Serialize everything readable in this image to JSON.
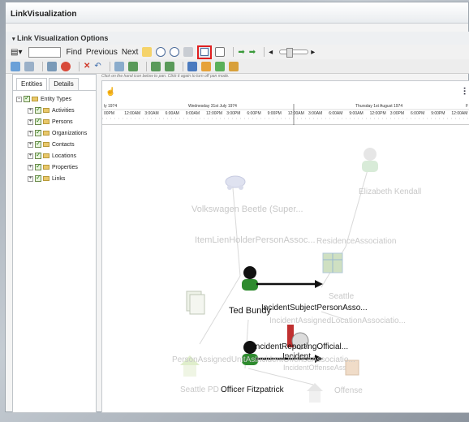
{
  "window": {
    "title": "LinkVisualization"
  },
  "panel": {
    "header": "Link Visualization Options"
  },
  "toolbar": {
    "find_label": "Find",
    "previous_label": "Previous",
    "next_label": "Next"
  },
  "side": {
    "tabs": [
      "Entities",
      "Details"
    ],
    "root": "Entity Types",
    "items": [
      "Activities",
      "Persons",
      "Organizations",
      "Contacts",
      "Locations",
      "Properties",
      "Links"
    ]
  },
  "hint": "Click on the hand icon below to pan. Click it again to turn off pan mode.",
  "timeline": {
    "left_partial": "ly 1974",
    "day1": "Wednesday 31st July 1974",
    "day2": "Thursday 1st August 1974",
    "right_partial": "F",
    "ticks_row1": [
      "00PM",
      "12:00AM",
      "3:00AM",
      "6:00AM",
      "9:00AM",
      "12:00PM",
      "3:00PM",
      "6:00PM",
      "9:00PM",
      "12:00AM",
      "3:00AM",
      "6:00AM",
      "9:00AM",
      "12:00PM",
      "3:00PM",
      "6:00PM",
      "9:00PM",
      "12:00AM"
    ]
  },
  "graph": {
    "nodes": {
      "vehicle": "Volkswagen Beetle (Super...",
      "lien": "ItemLienHolderPersonAssoc...",
      "elizabeth": "Elizabeth  Kendall",
      "residence": "ResidenceAssociation",
      "seattle": "Seattle",
      "ted": "Ted  Bundy",
      "incident_subject": "IncidentSubjectPersonAsso...",
      "incident_assigned": "IncidentAssignedLocationAssociatio...",
      "incident_offense": "IncidentOffenseAsso...",
      "incident": "Incident",
      "offense": "Offense",
      "reporting": "IncidentReportingOfficial...",
      "person_assigned": "PersonAssignedUnitAs...",
      "incident_officer": "IncidentOffenseAssociatio...",
      "seattle_pd": "Seattle PD",
      "officer": "Officer Fitzpatrick"
    }
  },
  "colors": {
    "highlight": "#e02020",
    "person": "#2e8b2e"
  }
}
